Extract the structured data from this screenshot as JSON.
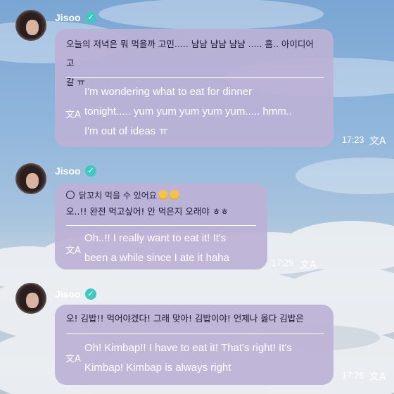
{
  "messages": [
    {
      "sender": "Jisoo",
      "korean_line1": "오늘의 저녁은 뭐 먹을까 고민..... 냠냠 냠냠 냠냠 ..... 흠.. 아이디어 고",
      "korean_line2": "갈 ㅠ",
      "english": [
        "I'm wondering what to eat for dinner",
        "tonight..... yum yum yum yum yum..... hmm..",
        "I'm out of ideas ㅠ"
      ],
      "time": "17:23"
    },
    {
      "sender": "Jisoo",
      "reply_quote": "닭꼬치 먹을 수 있어요",
      "korean_line1": "오..!! 완전 먹고싶어! 안 먹은지 오래야 ㅎㅎ",
      "english": [
        "Oh..!! I really want to eat it! It's",
        "been a while since I ate it haha"
      ],
      "time": "17:25"
    },
    {
      "sender": "Jisoo",
      "korean_line1": "오! 김밥!! 먹어야겠다! 그래 맞아! 김밥이야! 언제나 옳다 김밥은",
      "english": [
        "Oh! Kimbap!! I have to eat it! That's right! It's",
        "Kimbap! Kimbap is always right"
      ],
      "time": "17:26"
    }
  ],
  "icons": {
    "verified": "✓",
    "translate": "文A"
  },
  "colors": {
    "bubble": "#bcb2d6",
    "verified": "#3ec8c0"
  }
}
